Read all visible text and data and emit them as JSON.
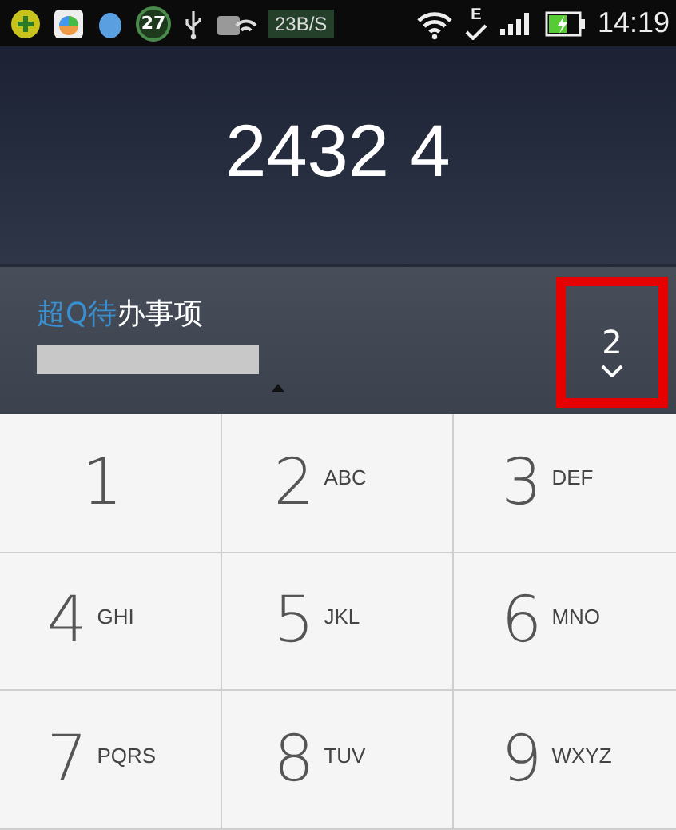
{
  "status_bar": {
    "notification_badge": "27",
    "network_speed": "23B/S",
    "network_type": "E",
    "battery": {
      "charging": true,
      "level": 0.6
    },
    "time": "14:19"
  },
  "dialed_number": "2432 4",
  "suggestion": {
    "title_parts": [
      {
        "text": "超Q待",
        "kind": "highlight"
      },
      {
        "text": "办事项",
        "kind": "plain"
      }
    ],
    "count": "2",
    "highlighted": true
  },
  "keypad": [
    {
      "digit": "1"
    },
    {
      "digit": "2",
      "letters": "ABC"
    },
    {
      "digit": "3",
      "letters": "DEF"
    },
    {
      "digit": "4",
      "letters": "GHI"
    },
    {
      "digit": "5",
      "letters": "JKL"
    },
    {
      "digit": "6",
      "letters": "MNO"
    },
    {
      "digit": "7",
      "letters": "PQRS"
    },
    {
      "digit": "8",
      "letters": "TUV"
    },
    {
      "digit": "9",
      "letters": "WXYZ"
    }
  ]
}
